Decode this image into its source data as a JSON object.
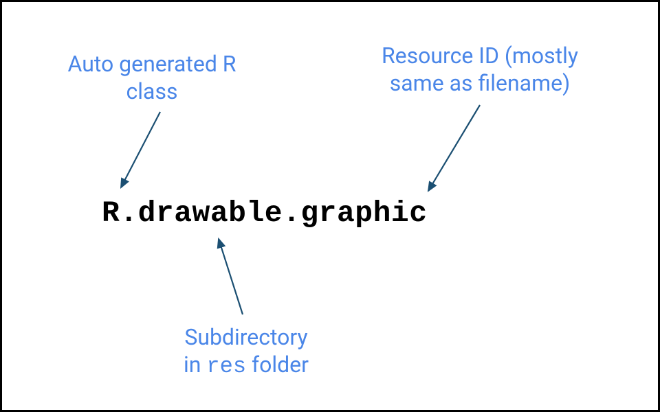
{
  "annotations": {
    "top_left_line1": "Auto generated R",
    "top_left_line2": "class",
    "top_right_line1": "Resource ID (mostly",
    "top_right_line2": "same as filename)",
    "bottom_line1": "Subdirectory",
    "bottom_line2_prefix": "in ",
    "bottom_line2_mono": "res",
    "bottom_line2_suffix": " folder"
  },
  "code": {
    "r_class": "R",
    "dot1": ".",
    "subdir": "drawable",
    "dot2": ".",
    "resource_id": "graphic"
  },
  "colors": {
    "annotation": "#4a86e8",
    "arrow": "#1b4f72",
    "code": "#000000"
  }
}
